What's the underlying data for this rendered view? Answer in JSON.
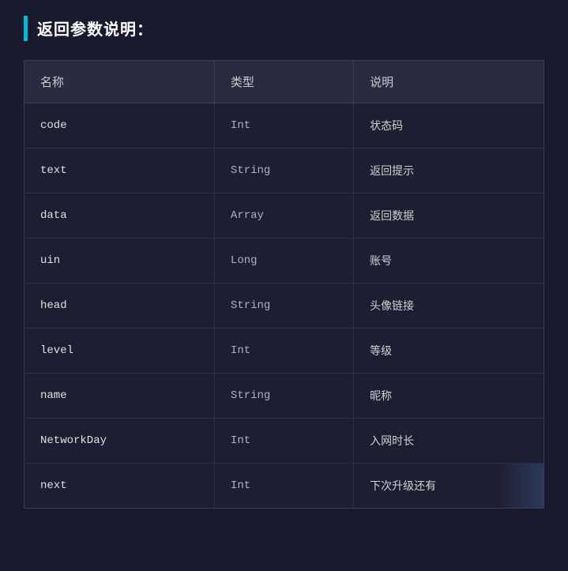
{
  "section": {
    "title": "返回参数说明："
  },
  "table": {
    "headers": [
      {
        "key": "name-header",
        "label": "名称"
      },
      {
        "key": "type-header",
        "label": "类型"
      },
      {
        "key": "desc-header",
        "label": "说明"
      }
    ],
    "rows": [
      {
        "name": "code",
        "type": "Int",
        "desc": "状态码"
      },
      {
        "name": "text",
        "type": "String",
        "desc": "返回提示"
      },
      {
        "name": "data",
        "type": "Array",
        "desc": "返回数据"
      },
      {
        "name": "uin",
        "type": "Long",
        "desc": "账号"
      },
      {
        "name": "head",
        "type": "String",
        "desc": "头像链接"
      },
      {
        "name": "level",
        "type": "Int",
        "desc": "等级"
      },
      {
        "name": "name",
        "type": "String",
        "desc": "昵称"
      },
      {
        "name": "NetworkDay",
        "type": "Int",
        "desc": "入网时长"
      },
      {
        "name": "next",
        "type": "Int",
        "desc": "下次升级还有",
        "truncated": true
      }
    ]
  }
}
